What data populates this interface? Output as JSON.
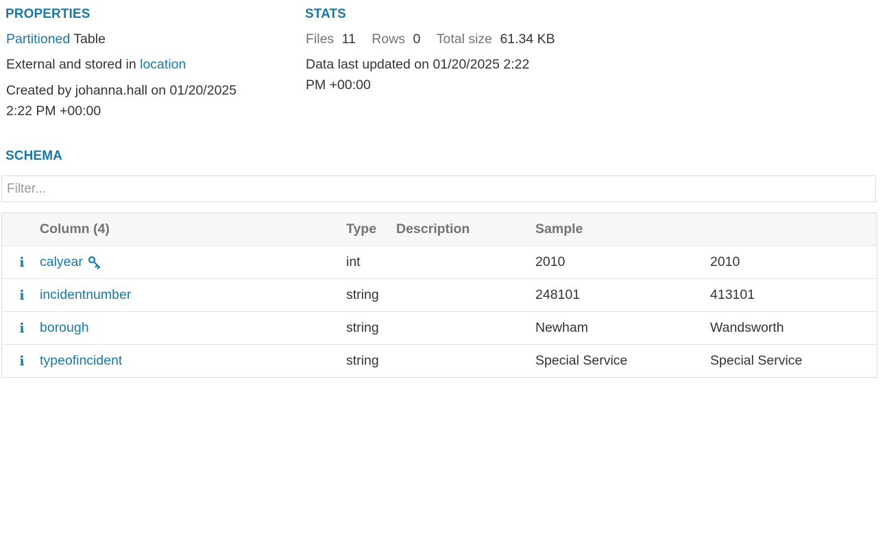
{
  "properties": {
    "title": "PROPERTIES",
    "partitioned_link": "Partitioned",
    "table_word": " Table",
    "external_text": "External and stored in ",
    "location_link": "location",
    "created_line1": "Created by johanna.hall on 01/20/2025",
    "created_line2": "2:22 PM +00:00"
  },
  "stats": {
    "title": "STATS",
    "files_label": "Files",
    "files_value": "11",
    "rows_label": "Rows",
    "rows_value": "0",
    "size_label": "Total size",
    "size_value": "61.34 KB",
    "updated_line1": "Data last updated on 01/20/2025 2:22",
    "updated_line2": "PM +00:00"
  },
  "schema": {
    "title": "SCHEMA",
    "filter_placeholder": "Filter...",
    "headers": {
      "column": "Column (4)",
      "type": "Type",
      "description": "Description",
      "sample": "Sample"
    },
    "rows": [
      {
        "name": "calyear",
        "type": "int",
        "sample1": "2010",
        "sample2": "2010",
        "is_key": true
      },
      {
        "name": "incidentnumber",
        "type": "string",
        "sample1": "248101",
        "sample2": "413101",
        "is_key": false
      },
      {
        "name": "borough",
        "type": "string",
        "sample1": "Newham",
        "sample2": "Wandsworth",
        "is_key": false
      },
      {
        "name": "typeofincident",
        "type": "string",
        "sample1": "Special Service",
        "sample2": "Special Service",
        "is_key": false
      }
    ]
  },
  "colors": {
    "accent": "#1a77a3",
    "text": "#333333",
    "muted": "#737373"
  },
  "icons": {
    "info": "info-icon",
    "key": "key-icon"
  }
}
